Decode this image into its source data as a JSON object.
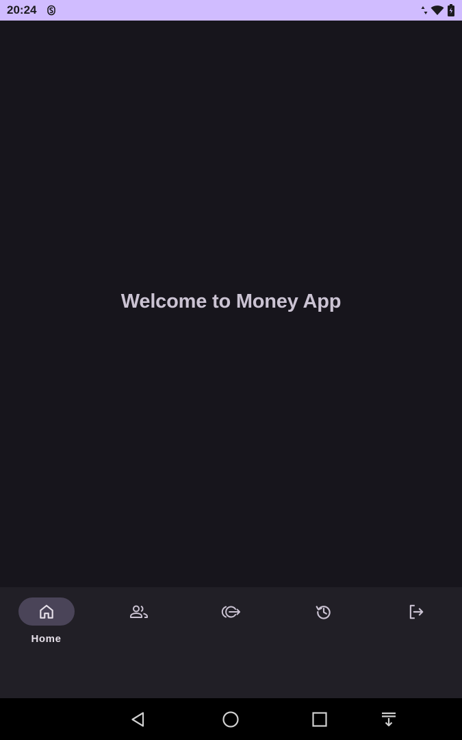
{
  "status_bar": {
    "time": "20:24",
    "icons": [
      "s-app-icon",
      "data-arrows-icon",
      "wifi-icon",
      "battery-icon"
    ],
    "background": "#d0bcff"
  },
  "main": {
    "welcome_text": "Welcome to Money App"
  },
  "bottom_nav": {
    "items": [
      {
        "icon": "home-icon",
        "label": "Home",
        "active": true
      },
      {
        "icon": "people-icon",
        "label": "",
        "active": false
      },
      {
        "icon": "transfer-icon",
        "label": "",
        "active": false
      },
      {
        "icon": "history-icon",
        "label": "",
        "active": false
      },
      {
        "icon": "logout-icon",
        "label": "",
        "active": false
      }
    ]
  },
  "system_nav": {
    "buttons": [
      "back-icon",
      "home-circle-icon",
      "recents-icon",
      "notification-shade-icon"
    ]
  },
  "colors": {
    "background": "#17151c",
    "nav_background": "#211f26",
    "active_pill": "#4a4458",
    "text": "#cbc3d3"
  }
}
